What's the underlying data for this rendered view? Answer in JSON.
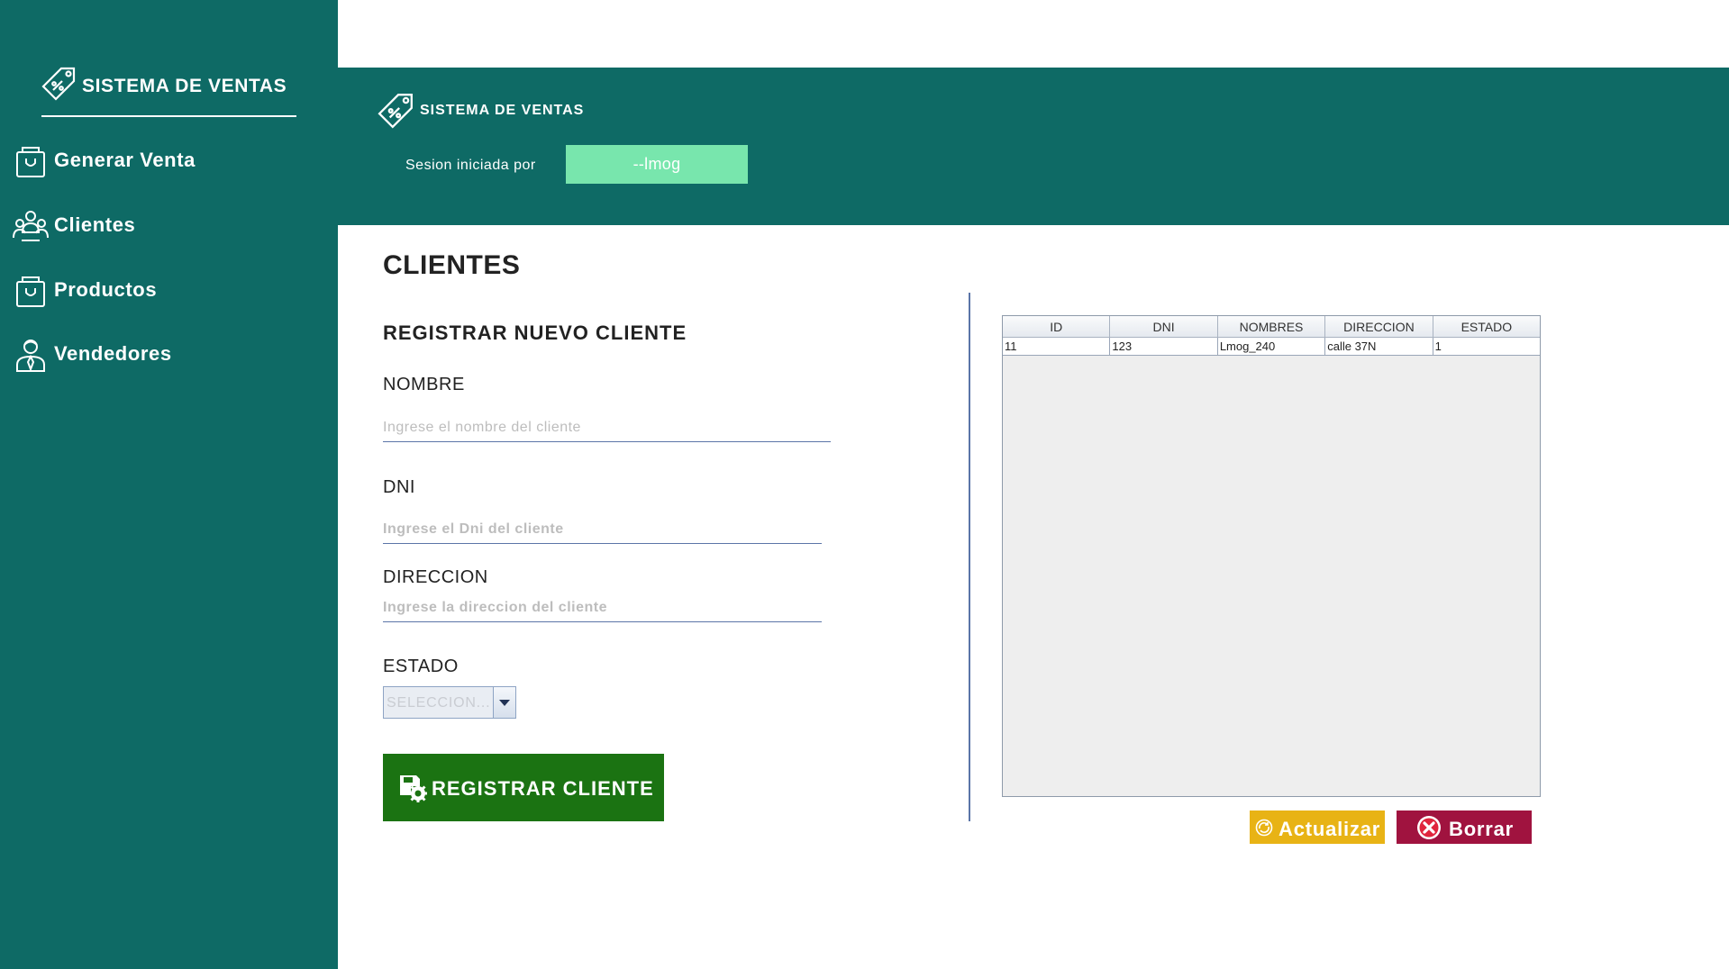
{
  "sidebar": {
    "brand": "SISTEMA DE VENTAS",
    "items": [
      {
        "label": "Generar Venta",
        "icon": "shopping-bag-icon"
      },
      {
        "label": "Clientes",
        "icon": "users-icon"
      },
      {
        "label": "Productos",
        "icon": "shopping-bag-icon"
      },
      {
        "label": "Vendedores",
        "icon": "seller-icon"
      }
    ]
  },
  "header": {
    "title": "SISTEMA DE VENTAS",
    "session_label": "Sesion iniciada por",
    "session_user": "--lmog"
  },
  "main": {
    "title": "CLIENTES",
    "form": {
      "subtitle": "REGISTRAR NUEVO CLIENTE",
      "nombre_label": "NOMBRE",
      "nombre_placeholder": "Ingrese el nombre del cliente",
      "dni_label": "DNI",
      "dni_placeholder": "Ingrese el Dni del cliente",
      "direccion_label": "DIRECCION",
      "direccion_placeholder": "Ingrese la direccion del cliente",
      "estado_label": "ESTADO",
      "estado_value": "SELECCION...",
      "register_button": "REGISTRAR CLIENTE"
    },
    "table": {
      "columns": [
        "ID",
        "DNI",
        "NOMBRES",
        "DIRECCION",
        "ESTADO"
      ],
      "rows": [
        [
          "11",
          "123",
          "Lmog_240",
          "calle 37N",
          "1"
        ]
      ]
    },
    "actions": {
      "update": "Actualizar",
      "delete": "Borrar"
    }
  },
  "colors": {
    "sidebar_bg": "#0e6a65",
    "session_field_bg": "#78e6ad",
    "register_button_bg": "#1b7312",
    "update_button_bg": "#e8b315",
    "delete_button_bg": "#a0133f"
  }
}
